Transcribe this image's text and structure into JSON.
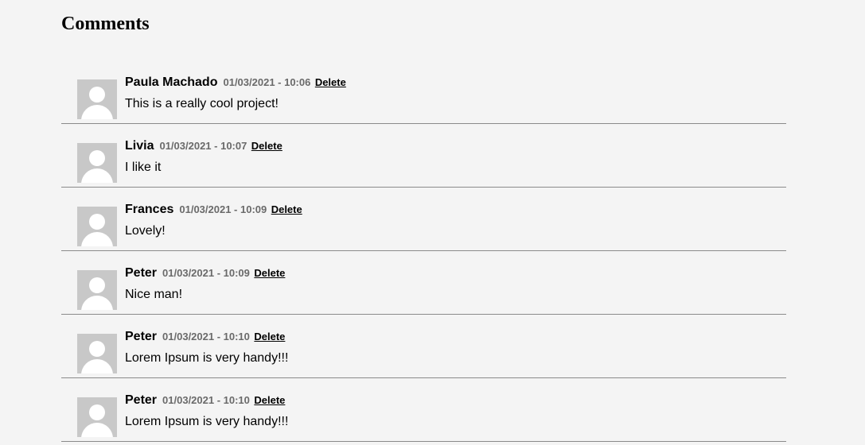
{
  "heading": "Comments",
  "avatar_icon": "user-silhouette-icon",
  "comments": [
    {
      "author": "Paula Machado",
      "date": "01/03/2021 - 10:06",
      "delete_label": "Delete",
      "text": "This is a really cool project!"
    },
    {
      "author": "Livia",
      "date": "01/03/2021 - 10:07",
      "delete_label": "Delete",
      "text": "I like it"
    },
    {
      "author": "Frances",
      "date": "01/03/2021 - 10:09",
      "delete_label": "Delete",
      "text": "Lovely!"
    },
    {
      "author": "Peter",
      "date": "01/03/2021 - 10:09",
      "delete_label": "Delete",
      "text": "Nice man!"
    },
    {
      "author": "Peter",
      "date": "01/03/2021 - 10:10",
      "delete_label": "Delete",
      "text": "Lorem Ipsum is very handy!!!"
    },
    {
      "author": "Peter",
      "date": "01/03/2021 - 10:10",
      "delete_label": "Delete",
      "text": "Lorem Ipsum is very handy!!!"
    }
  ]
}
